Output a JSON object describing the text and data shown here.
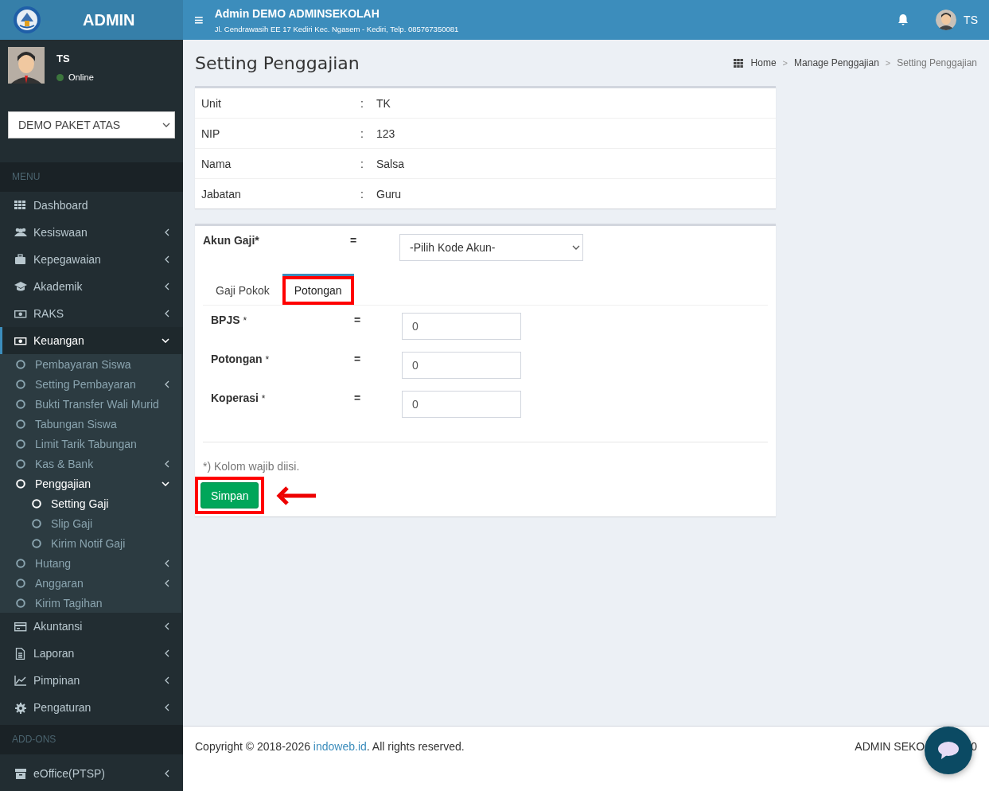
{
  "header": {
    "logo_text": "ADMIN",
    "school_title": "Admin DEMO ADMINSEKOLAH",
    "school_address": "Jl. Cendrawasih EE 17 Kediri Kec. Ngasem - Kediri, Telp. 085767350081",
    "menu_toggle": "≡",
    "user_initials": "TS"
  },
  "sidebar": {
    "user": {
      "name": "TS",
      "status": "Online"
    },
    "unit_select": {
      "value": "DEMO PAKET ATAS"
    },
    "menu_header": "MENU",
    "items": [
      {
        "label": "Dashboard",
        "selected": false
      },
      {
        "label": "Kesiswaan",
        "expanded": false,
        "selected": false
      },
      {
        "label": "Kepegawaian",
        "expanded": false,
        "selected": false
      },
      {
        "label": "Akademik",
        "expanded": false,
        "selected": false
      },
      {
        "label": "RAKS",
        "expanded": false,
        "selected": false
      },
      {
        "label": "Keuangan",
        "expanded": true,
        "selected": true,
        "children": [
          {
            "label": "Pembayaran Siswa",
            "selected": false
          },
          {
            "label": "Setting Pembayaran",
            "expanded": false,
            "selected": false
          },
          {
            "label": "Bukti Transfer Wali Murid",
            "selected": false
          },
          {
            "label": "Tabungan Siswa",
            "selected": false
          },
          {
            "label": "Limit Tarik Tabungan",
            "selected": false
          },
          {
            "label": "Kas & Bank",
            "expanded": false,
            "selected": false
          },
          {
            "label": "Penggajian",
            "expanded": true,
            "selected": true,
            "children": [
              {
                "label": "Setting Gaji",
                "selected": true
              },
              {
                "label": "Slip Gaji",
                "selected": false
              },
              {
                "label": "Kirim Notif Gaji",
                "selected": false
              }
            ]
          },
          {
            "label": "Hutang",
            "expanded": false,
            "selected": false
          },
          {
            "label": "Anggaran",
            "expanded": false,
            "selected": false
          },
          {
            "label": "Kirim Tagihan",
            "selected": false
          }
        ]
      },
      {
        "label": "Akuntansi",
        "expanded": false,
        "selected": false
      },
      {
        "label": "Laporan",
        "expanded": false,
        "selected": false
      },
      {
        "label": "Pimpinan",
        "expanded": false,
        "selected": false
      },
      {
        "label": "Pengaturan",
        "expanded": false,
        "selected": false
      }
    ],
    "addons_header": "ADD-ONS",
    "addons": [
      {
        "label": "eOffice(PTSP)",
        "expanded": false,
        "selected": false
      }
    ]
  },
  "page": {
    "title": "Setting Penggajian",
    "breadcrumb": [
      {
        "label": "Home",
        "current": false
      },
      {
        "label": "Manage Penggajian",
        "current": false
      },
      {
        "label": "Setting Penggajian",
        "current": true
      }
    ],
    "breadcrumb_separator": ">",
    "info": [
      {
        "label": "Unit",
        "separator": ":",
        "value": "TK"
      },
      {
        "label": "NIP",
        "separator": ":",
        "value": "123"
      },
      {
        "label": "Nama",
        "separator": ":",
        "value": "Salsa"
      },
      {
        "label": "Jabatan",
        "separator": ":",
        "value": "Guru"
      }
    ],
    "form": {
      "account": {
        "label": "Akun Gaji*",
        "separator": "=",
        "select": "-Pilih Kode Akun-"
      },
      "tabs": [
        {
          "label": "Gaji Pokok",
          "selected": false,
          "highlighted": false
        },
        {
          "label": "Potongan",
          "selected": true,
          "highlighted": true
        }
      ],
      "fields": [
        {
          "label": "BPJS",
          "required": "*",
          "separator": "=",
          "value": "0"
        },
        {
          "label": "Potongan",
          "required": "*",
          "separator": "=",
          "value": "0"
        },
        {
          "label": "Koperasi",
          "required": "*",
          "separator": "=",
          "value": "0"
        }
      ],
      "note": "*) Kolom wajib diisi.",
      "submit": {
        "label": "Simpan",
        "highlighted": true
      }
    }
  },
  "footer": {
    "copyright_prefix": "Copyright © 2018-2026 ",
    "link": "indoweb.id",
    "copyright_suffix": ". All rights reserved.",
    "right_text": "ADMIN SEKO",
    "right_text_tail": "0"
  }
}
